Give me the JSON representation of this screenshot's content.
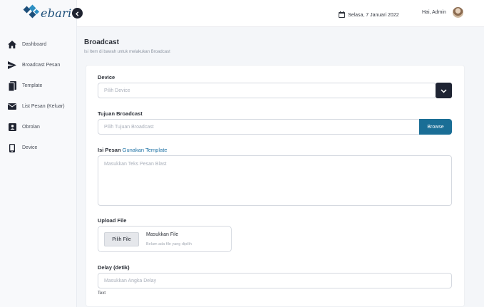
{
  "app": {
    "logo_text": "ebari"
  },
  "sidebar": {
    "items": [
      {
        "label": "Dashboard",
        "icon": "home-icon"
      },
      {
        "label": "Broadcast Pesan",
        "icon": "send-icon"
      },
      {
        "label": "Template",
        "icon": "template-icon"
      },
      {
        "label": "List Pesan (Keluar)",
        "icon": "mail-icon"
      },
      {
        "label": "Obrolan",
        "icon": "chat-icon"
      },
      {
        "label": "Device",
        "icon": "device-icon"
      }
    ]
  },
  "topbar": {
    "date": "Selasa, 7 Januari 2022",
    "greeting": "Hai, Admin"
  },
  "page": {
    "title": "Broadcast",
    "subtitle": "Isi Item di bawah untuk melakukan Broadcast"
  },
  "form": {
    "device": {
      "label": "Device",
      "placeholder": "Pilih Device"
    },
    "tujuan": {
      "label": "Tujuan Broadcast",
      "placeholder": "Pilih Tujuan Broadcast",
      "button": "Browse"
    },
    "pesan": {
      "label": "Isi Pesan",
      "link": "Gunakan Template",
      "placeholder": "Masukkan Teks Pesan Blast"
    },
    "upload": {
      "label": "Upload File",
      "button": "Pilih File",
      "title": "Masukkan File",
      "status": "Belum ada file yang dipilih"
    },
    "delay": {
      "label": "Delay (detik)",
      "placeholder": "Masukkan Angka Delay",
      "help": "Text"
    }
  },
  "colors": {
    "brand": "#1d4f7a",
    "browse": "#1a6e96",
    "dark": "#1f2433",
    "link": "#1a6fa3"
  }
}
